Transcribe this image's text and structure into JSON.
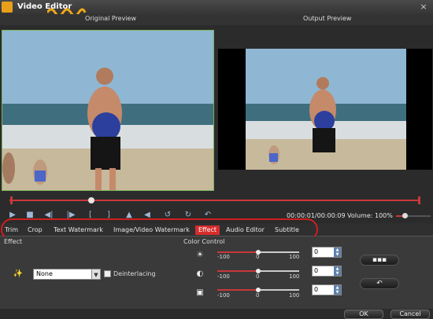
{
  "window": {
    "title": "Video Editor",
    "close_glyph": "×"
  },
  "preview": {
    "original_label": "Original Preview",
    "output_label": "Output Preview"
  },
  "timeline": {
    "position_fraction": 0.2
  },
  "controls": {
    "time": "00:00:01/00:00:09",
    "volume_label": "Volume:",
    "volume_value": "100%"
  },
  "tabs": [
    {
      "label": "Trim"
    },
    {
      "label": "Crop"
    },
    {
      "label": "Text Watermark"
    },
    {
      "label": "Image/Video Watermark"
    },
    {
      "label": "Effect"
    },
    {
      "label": "Audio Editor"
    },
    {
      "label": "Subtitle"
    }
  ],
  "effect": {
    "section_label": "Effect",
    "selected": "None",
    "deinterlacing_label": "Deinterlacing"
  },
  "color_control": {
    "section_label": "Color Control",
    "sliders": [
      {
        "icon": "brightness-icon",
        "min": "-100",
        "mid": "0",
        "max": "100",
        "value": "0"
      },
      {
        "icon": "contrast-icon",
        "min": "-100",
        "mid": "0",
        "max": "100",
        "value": "0"
      },
      {
        "icon": "saturation-icon",
        "min": "-100",
        "mid": "0",
        "max": "100",
        "value": "0"
      }
    ]
  },
  "buttons": {
    "ok": "OK",
    "cancel": "Cancel"
  },
  "colors": {
    "accent": "#d62d2d",
    "highlight": "#cf1e1e",
    "green_border": "#7bb35a"
  }
}
